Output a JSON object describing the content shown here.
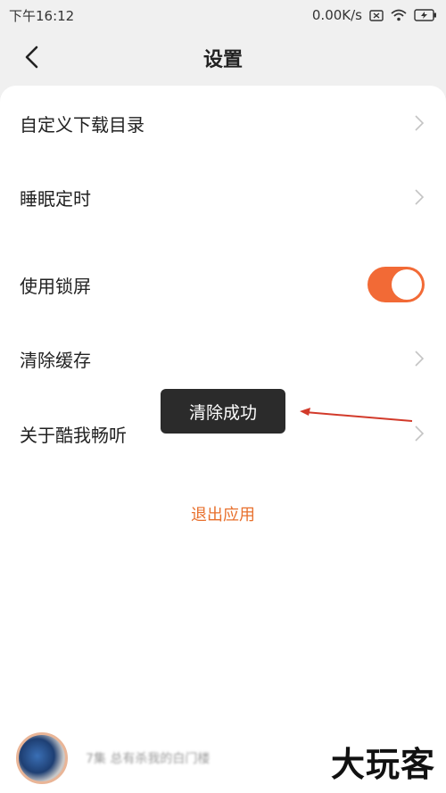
{
  "status_bar": {
    "time": "下午16:12",
    "network_speed": "0.00K/s",
    "icons": [
      "sim-off-icon",
      "wifi-icon",
      "battery-charging-icon"
    ]
  },
  "header": {
    "title": "设置",
    "back_icon": "chevron-left-icon"
  },
  "settings": {
    "items": [
      {
        "label": "自定义下载目录",
        "control": "chevron-right-icon"
      },
      {
        "label": "睡眠定时",
        "control": "chevron-right-icon"
      },
      {
        "label": "使用锁屏",
        "control": "toggle",
        "toggle_on": true
      },
      {
        "label": "清除缓存",
        "control": "chevron-right-icon"
      },
      {
        "label": "关于酷我畅听",
        "control": "chevron-right-icon"
      }
    ],
    "exit_label": "退出应用"
  },
  "toast": {
    "message": "清除成功"
  },
  "colors": {
    "accent": "#f26a36",
    "exit_text": "#e8702d",
    "background": "#f0f0f0",
    "card": "#ffffff",
    "toast_bg": "#2b2b2b",
    "annotation": "#d23a2a"
  },
  "player": {
    "now_playing": "7集 总有杀我的白门楼"
  },
  "watermark": {
    "text": "大玩客"
  }
}
